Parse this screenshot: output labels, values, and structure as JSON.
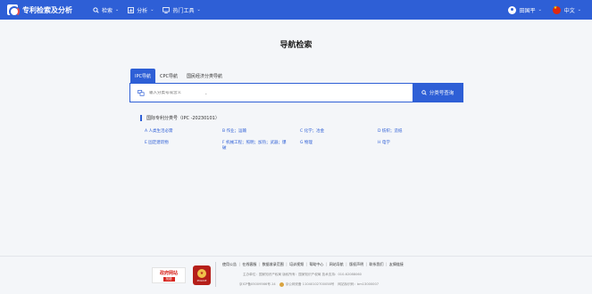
{
  "header": {
    "brand_title": "专利检索及分析",
    "nav": [
      {
        "label": "检索",
        "icon": "search-icon"
      },
      {
        "label": "分析",
        "icon": "chart-icon"
      },
      {
        "label": "热门工具",
        "icon": "monitor-icon"
      }
    ],
    "user_name": "田国平",
    "language": "中文"
  },
  "page_title": "导航检索",
  "tabs": [
    "IPC导航",
    "CPC导航",
    "国民经济分类导航"
  ],
  "search": {
    "placeholder": "输入分类号或含义",
    "button_label": "分类号查询"
  },
  "section_title": "国际专利分类号（IPC -20230101）",
  "ipc_items": [
    "A 人类生活必需",
    "B 作业；运输",
    "C 化学；冶金",
    "D 纺织；造纸",
    "E 固定建筑物",
    "F 机械工程；照明；加热；武器；爆破",
    "G 物理",
    "H 电学"
  ],
  "footer": {
    "badge1_top": "政府网站",
    "badge1_bottom": "找错",
    "badge2_text": "POLICE",
    "links": [
      "使用公告",
      "在线客服",
      "数据收录范围",
      "培训视频",
      "帮助中心",
      "网站导航",
      "版权声明",
      "联系我们",
      "友情链接"
    ],
    "info_line": "主办单位：国家知识产权局    版权所有：国家知识产权局    技术支持：010-62088060",
    "icp": "京ICP备05009566号-14",
    "police": "京公网安备 11040102700058号",
    "site_code": "网站标识码：bm13000007"
  },
  "colors": {
    "primary": "#2e5fd6",
    "background": "#f4f6f9"
  }
}
